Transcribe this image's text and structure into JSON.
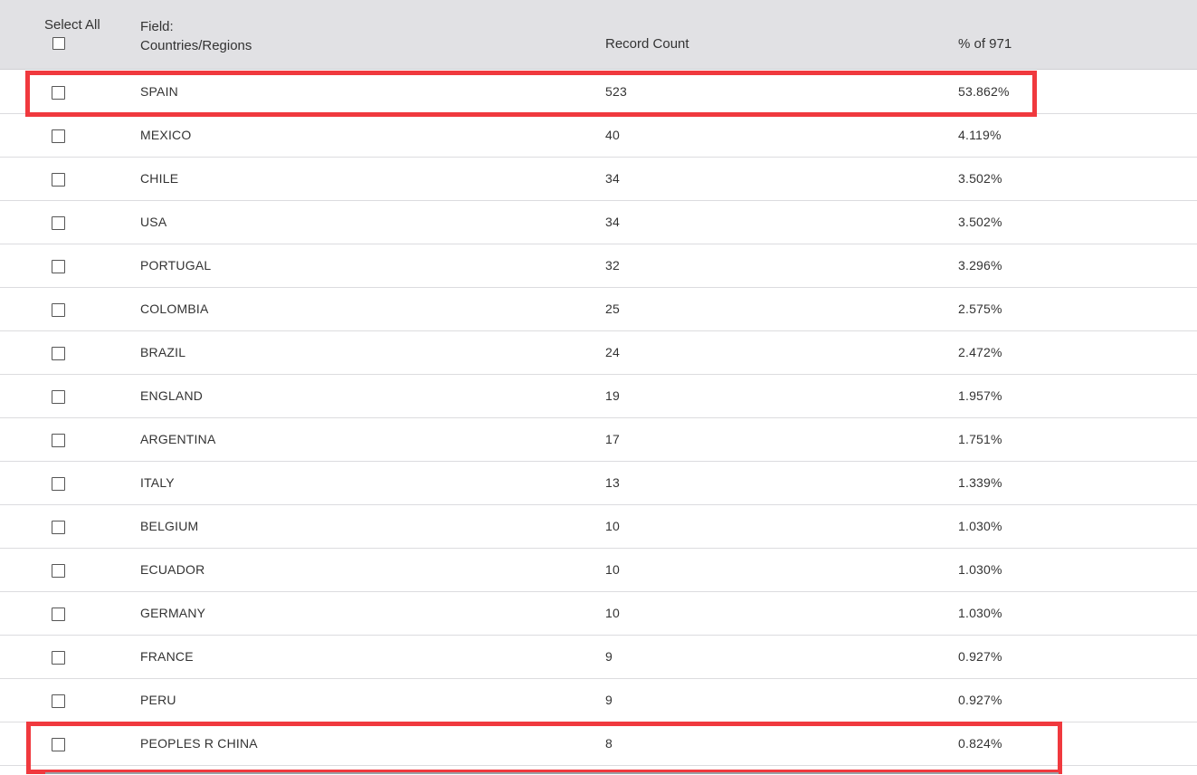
{
  "header": {
    "select_all_label": "Select All",
    "field_label_line1": "Field:",
    "field_label_line2": "Countries/Regions",
    "record_count_label": "Record Count",
    "percent_label": "% of 971"
  },
  "rows": [
    {
      "name": "SPAIN",
      "count": "523",
      "pct": "53.862%"
    },
    {
      "name": "MEXICO",
      "count": "40",
      "pct": "4.119%"
    },
    {
      "name": "CHILE",
      "count": "34",
      "pct": "3.502%"
    },
    {
      "name": "USA",
      "count": "34",
      "pct": "3.502%"
    },
    {
      "name": "PORTUGAL",
      "count": "32",
      "pct": "3.296%"
    },
    {
      "name": "COLOMBIA",
      "count": "25",
      "pct": "2.575%"
    },
    {
      "name": "BRAZIL",
      "count": "24",
      "pct": "2.472%"
    },
    {
      "name": "ENGLAND",
      "count": "19",
      "pct": "1.957%"
    },
    {
      "name": "ARGENTINA",
      "count": "17",
      "pct": "1.751%"
    },
    {
      "name": "ITALY",
      "count": "13",
      "pct": "1.339%"
    },
    {
      "name": "BELGIUM",
      "count": "10",
      "pct": "1.030%"
    },
    {
      "name": "ECUADOR",
      "count": "10",
      "pct": "1.030%"
    },
    {
      "name": "GERMANY",
      "count": "10",
      "pct": "1.030%"
    },
    {
      "name": "FRANCE",
      "count": "9",
      "pct": "0.927%"
    },
    {
      "name": "PERU",
      "count": "9",
      "pct": "0.927%"
    },
    {
      "name": "PEOPLES R CHINA",
      "count": "8",
      "pct": "0.824%"
    }
  ],
  "colors": {
    "header_bg": "#e1e1e4",
    "highlight": "#f0393e",
    "text": "#333333"
  }
}
